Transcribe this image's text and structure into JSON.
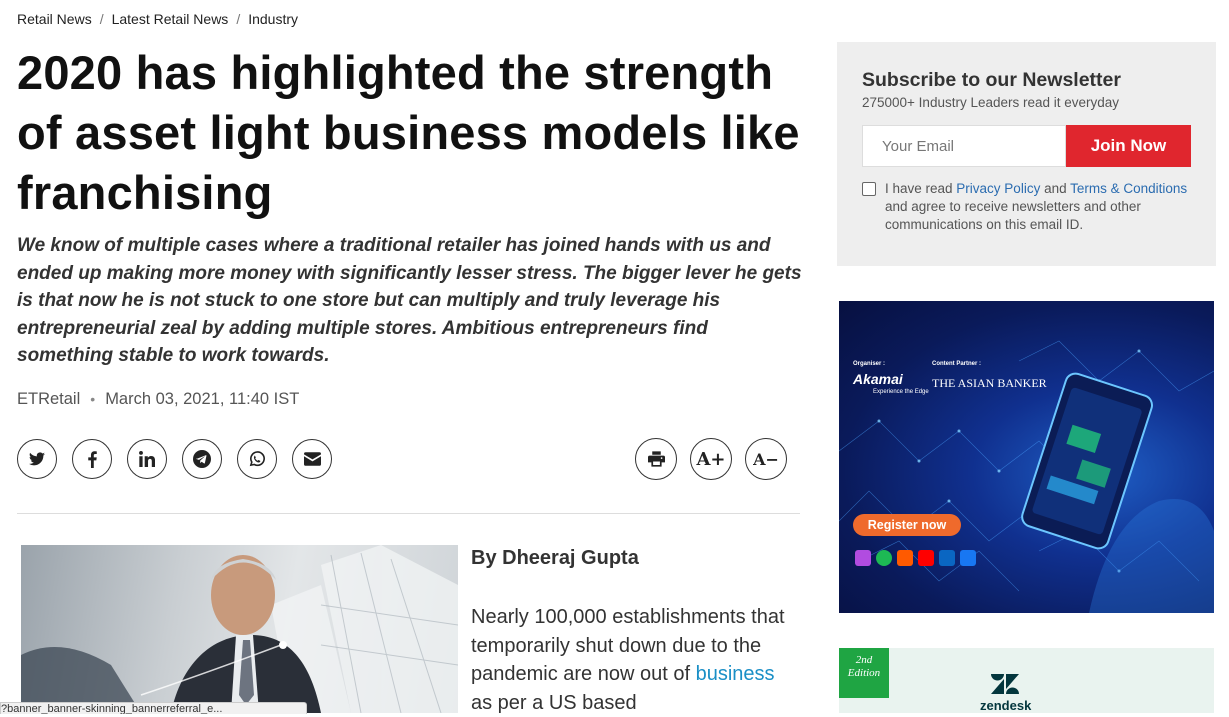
{
  "breadcrumb": [
    "Retail News",
    "Latest Retail News",
    "Industry"
  ],
  "article": {
    "headline": "2020 has highlighted the strength of asset light business models like franchising",
    "summary": "We know of multiple cases where a traditional retailer has joined hands with us and ended up making more money with significantly lesser stress. The bigger lever he gets is that now he is not stuck to one store but can multiply and truly leverage his entrepreneurial zeal by adding multiple stores. Ambitious entrepreneurs find something stable to work towards.",
    "source": "ETRetail",
    "separator": "•",
    "date": "March 03, 2021, 11:40 IST",
    "author": "By Dheeraj Gupta",
    "body_before_link": "Nearly 100,000 establishments that temporarily shut down due to the pandemic are now out of ",
    "body_link": "business",
    "body_after_link": " as per a US based"
  },
  "share_buttons": [
    "twitter-icon",
    "facebook-icon",
    "linkedin-icon",
    "telegram-icon",
    "whatsapp-icon",
    "email-icon"
  ],
  "tools": {
    "print": "print-icon",
    "font_increase": "A+",
    "font_decrease": "A−"
  },
  "newsletter": {
    "title": "Subscribe to our Newsletter",
    "subtitle": "275000+ Industry Leaders read it everyday",
    "email_placeholder": "Your Email",
    "join_label": "Join Now",
    "consent_prefix": "I have read ",
    "privacy_link": "Privacy Policy",
    "consent_and": " and ",
    "terms_link": "Terms & Conditions",
    "consent_suffix": " and agree to receive newsletters and other communications on this email ID."
  },
  "ad1": {
    "organiser_label": "Organiser :",
    "content_partner_label": "Content Partner :",
    "akamai": "Akamai",
    "akamai_tagline": "Experience the Edge",
    "banker": "THE ASIAN BANKER",
    "register": "Register now"
  },
  "ad2": {
    "edition": "2nd Edition",
    "brand": "zendesk"
  },
  "status_bar": "?banner_banner-skinning_bannerreferral_e..."
}
